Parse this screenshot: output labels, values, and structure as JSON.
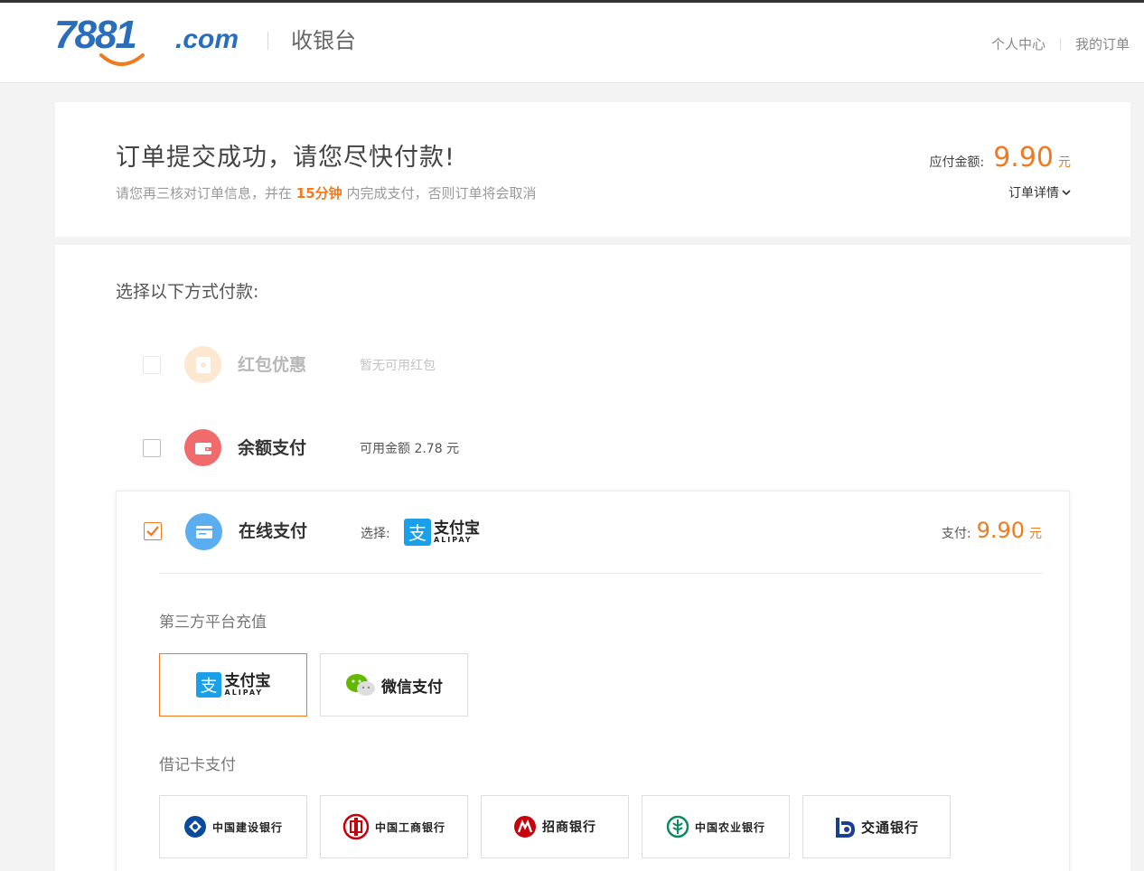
{
  "header": {
    "logo_text": "7881.com",
    "page_title": "收银台",
    "links": [
      "个人中心",
      "我的订单"
    ]
  },
  "order": {
    "title": "订单提交成功，请您尽快付款!",
    "subtitle_before": "请您再三核对订单信息，并在",
    "subtitle_highlight": "15分钟",
    "subtitle_after": "内完成支付，否则订单将会取消",
    "amount_label": "应付金额:",
    "amount_value": "9.90",
    "amount_unit": "元",
    "detail_label": "订单详情"
  },
  "payment": {
    "choose_label": "选择以下方式付款:",
    "methods": [
      {
        "label": "红包优惠",
        "info": "暂无可用红包",
        "disabled": true,
        "checked": false
      },
      {
        "label": "余额支付",
        "info": "可用金额 2.78 元",
        "disabled": false,
        "checked": false
      },
      {
        "label": "在线支付",
        "info": "选择:",
        "disabled": false,
        "checked": true
      }
    ],
    "online": {
      "pay_label": "支付:",
      "pay_value": "9.90",
      "pay_unit": "元",
      "selected_logo": "支付宝",
      "third_party_label": "第三方平台充值",
      "third_party": [
        {
          "name": "支付宝",
          "sub": "ALIPAY",
          "selected": true
        },
        {
          "name": "微信支付",
          "selected": false
        }
      ],
      "debit_label": "借记卡支付",
      "banks": [
        "中国建设银行",
        "中国工商银行",
        "招商银行",
        "中国农业银行",
        "交通银行"
      ]
    }
  },
  "colors": {
    "accent": "#f07a1f",
    "logo_blue": "#2a6ebb",
    "alipay_blue": "#1aa0e8",
    "wechat_green": "#62b900"
  }
}
